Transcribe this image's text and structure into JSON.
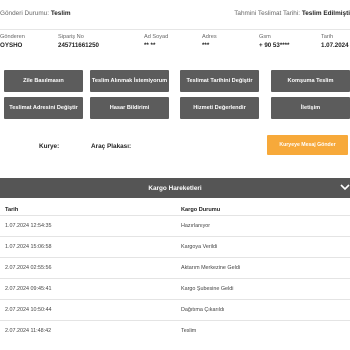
{
  "status": {
    "sender_status_label": "Gönderi Durumu:",
    "sender_status_value": "Teslim",
    "estimated_delivery_label": "Tahmini Teslimat Tarihi:",
    "estimated_delivery_value": "Teslim Edilmişti"
  },
  "info": [
    {
      "key": "Gönderen",
      "value": "OYSHO"
    },
    {
      "key": "Sipariş No",
      "value": "245711661250"
    },
    {
      "key": "Ad Soyad",
      "value": "**    **"
    },
    {
      "key": "Adres",
      "value": "***"
    },
    {
      "key": "Gsm",
      "value": "+ 90 53****"
    },
    {
      "key": "Tarih",
      "value": "1.07.2024"
    }
  ],
  "actions": [
    {
      "label": "Zile Basılmasın"
    },
    {
      "label": "Teslim Alınmak İstemiyorum"
    },
    {
      "label": "Teslimat Tarihini Değiştir"
    },
    {
      "label": "Komşuma Teslim"
    },
    {
      "label": "Teslimat Adresini Değiştir"
    },
    {
      "label": "Hasar Bildirimi"
    },
    {
      "label": "Hizmeti Değerlendir"
    },
    {
      "label": "İletişim"
    }
  ],
  "courier": {
    "courier_label": "Kurye:",
    "vehicle_label": "Araç Plakası:",
    "send_message_label": "Kuryeye Mesaj Gönder"
  },
  "moves": {
    "title": "Kargo Hareketleri",
    "col_date": "Tarih",
    "col_status": "Kargo Durumu",
    "rows": [
      {
        "date": "1.07.2024 12:54:35",
        "status": "Hazırlanıyor"
      },
      {
        "date": "1.07.2024 15:06:58",
        "status": "Kargoya Verildi"
      },
      {
        "date": "2.07.2024 02:55:56",
        "status": "Aktarım Merkezine Geldi"
      },
      {
        "date": "2.07.2024 09:45:41",
        "status": "Kargo Şubesine Geldi"
      },
      {
        "date": "2.07.2024 10:50:44",
        "status": "Dağıtıma Çıkarıldı"
      },
      {
        "date": "2.07.2024 11:48:42",
        "status": "Teslim"
      }
    ]
  }
}
